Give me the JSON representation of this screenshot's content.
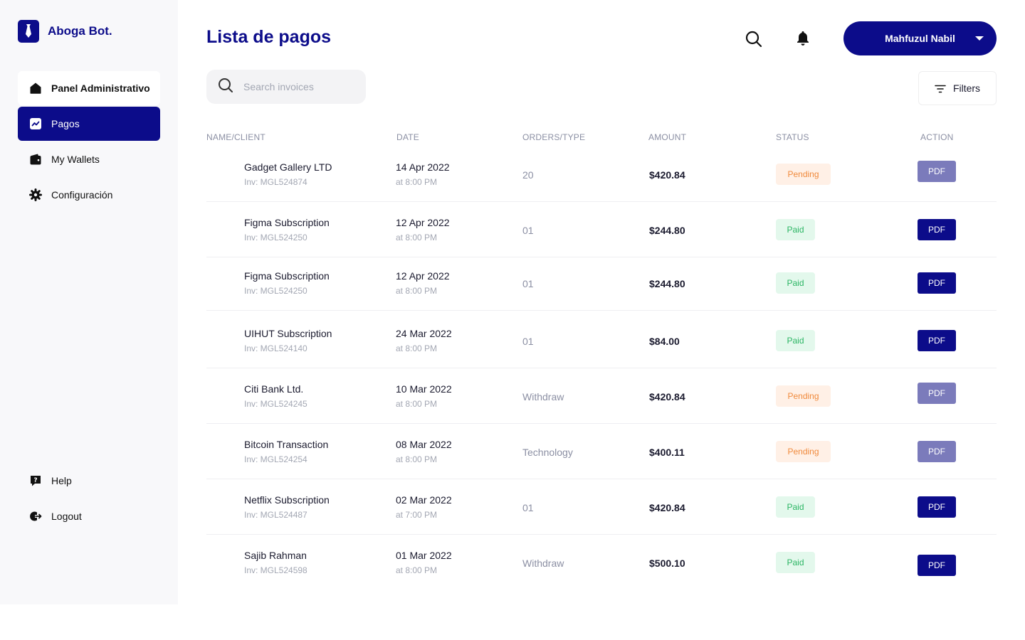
{
  "brand": {
    "name": "Aboga Bot."
  },
  "sidebar": {
    "items": [
      {
        "label": "Panel Administrativo",
        "icon": "home-icon"
      },
      {
        "label": "Pagos",
        "icon": "chart-icon"
      },
      {
        "label": "My Wallets",
        "icon": "wallet-icon"
      },
      {
        "label": "Configuración",
        "icon": "gear-icon"
      }
    ],
    "bottom": [
      {
        "label": "Help",
        "icon": "help-icon"
      },
      {
        "label": "Logout",
        "icon": "logout-icon"
      }
    ]
  },
  "header": {
    "title": "Lista de pagos",
    "user": "Mahfuzul Nabil"
  },
  "search": {
    "placeholder": "Search invoices",
    "value": ""
  },
  "filters": {
    "label": "Filters"
  },
  "table": {
    "columns": [
      "NAME/CLIENT",
      "DATE",
      "ORDERS/TYPE",
      "AMOUNT",
      "STATUS",
      "ACTION"
    ],
    "rows": [
      {
        "name": "Gadget Gallery LTD",
        "invoice": "Inv: MGL524874",
        "date": "14 Apr 2022",
        "time": "at 8:00 PM",
        "type": "20",
        "amount": "$420.84",
        "status": "Pending",
        "action": "PDF"
      },
      {
        "name": "Figma Subscription",
        "invoice": "Inv: MGL524250",
        "date": "12 Apr 2022",
        "time": "at 8:00 PM",
        "type": "01",
        "amount": "$244.80",
        "status": "Paid",
        "action": "PDF"
      },
      {
        "name": "Figma Subscription",
        "invoice": "Inv: MGL524250",
        "date": "12 Apr 2022",
        "time": "at 8:00 PM",
        "type": "01",
        "amount": "$244.80",
        "status": "Paid",
        "action": "PDF"
      },
      {
        "name": "UIHUT Subscription",
        "invoice": "Inv: MGL524140",
        "date": "24 Mar 2022",
        "time": "at 8:00 PM",
        "type": "01",
        "amount": "$84.00",
        "status": "Paid",
        "action": "PDF"
      },
      {
        "name": "Citi Bank Ltd.",
        "invoice": "Inv: MGL524245",
        "date": "10 Mar 2022",
        "time": "at 8:00 PM",
        "type": "Withdraw",
        "amount": "$420.84",
        "status": "Pending",
        "action": "PDF"
      },
      {
        "name": "Bitcoin Transaction",
        "invoice": "Inv: MGL524254",
        "date": "08 Mar 2022",
        "time": "at 8:00 PM",
        "type": "Technology",
        "amount": "$400.11",
        "status": "Pending",
        "action": "PDF"
      },
      {
        "name": "Netflix Subscription",
        "invoice": "Inv: MGL524487",
        "date": "02 Mar 2022",
        "time": "at 7:00 PM",
        "type": "01",
        "amount": "$420.84",
        "status": "Paid",
        "action": "PDF"
      },
      {
        "name": "Sajib Rahman",
        "invoice": "Inv: MGL524598",
        "date": "01 Mar 2022",
        "time": "at 8:00 PM",
        "type": "Withdraw",
        "amount": "$500.10",
        "status": "Paid",
        "action": "PDF"
      }
    ]
  },
  "colors": {
    "brand": "#0c0c8a",
    "pending": "#f08a3c",
    "paid": "#2cb564",
    "pdf_pending": "#7b7bbb"
  }
}
